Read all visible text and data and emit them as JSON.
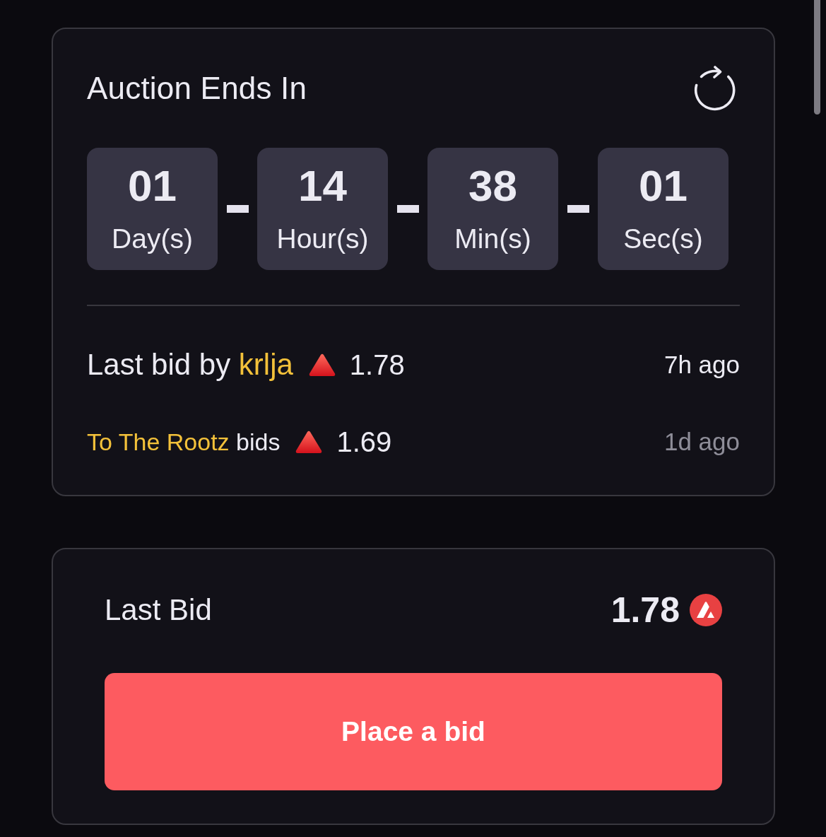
{
  "auction": {
    "title": "Auction Ends In",
    "countdown": [
      {
        "value": "01",
        "label": "Day(s)"
      },
      {
        "value": "14",
        "label": "Hour(s)"
      },
      {
        "value": "38",
        "label": "Min(s)"
      },
      {
        "value": "01",
        "label": "Sec(s)"
      }
    ],
    "bids": [
      {
        "kind": "latest",
        "prefix": "Last bid by",
        "bidder": "krlja",
        "amount": "1.78",
        "time": "7h ago"
      },
      {
        "kind": "previous",
        "bidder": "To The Rootz",
        "suffix": "bids",
        "amount": "1.69",
        "time": "1d ago"
      }
    ]
  },
  "bid_panel": {
    "label": "Last Bid",
    "amount": "1.78",
    "button": "Place a bid"
  }
}
